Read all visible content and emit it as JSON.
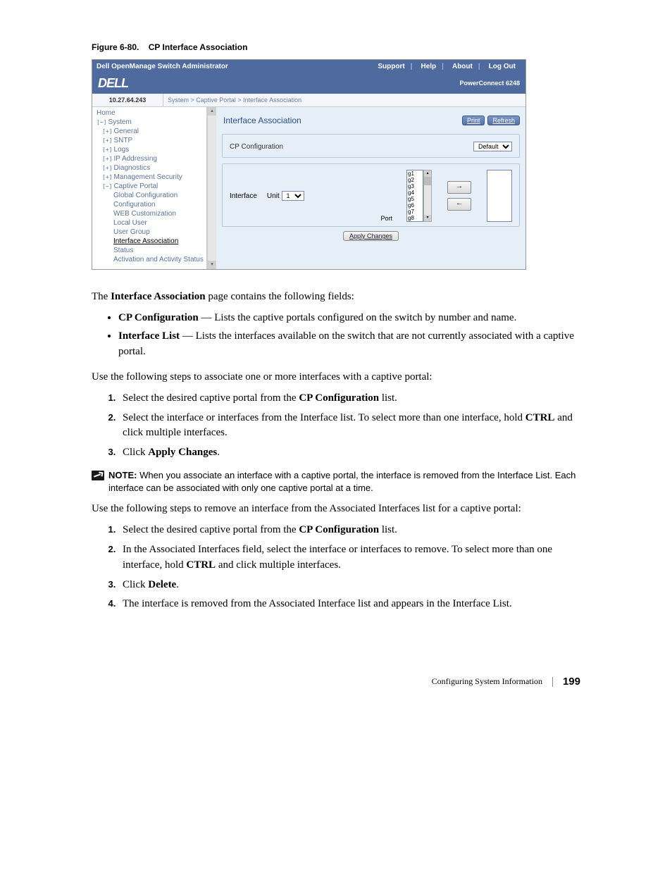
{
  "figure_caption_prefix": "Figure 6-80.",
  "figure_caption_title": "CP Interface Association",
  "screenshot": {
    "topbar": {
      "title": "Dell OpenManage Switch Administrator",
      "nav": [
        "Support",
        "Help",
        "About",
        "Log Out"
      ]
    },
    "logo": "DELL",
    "product": "PowerConnect 6248",
    "ip": "10.27.64.243",
    "breadcrumb": "System > Captive Portal > Interface Association",
    "tree": {
      "items": [
        {
          "label": "Home",
          "level": 0,
          "toggle": ""
        },
        {
          "label": "System",
          "level": 0,
          "toggle": "−"
        },
        {
          "label": "General",
          "level": 1,
          "toggle": "+"
        },
        {
          "label": "SNTP",
          "level": 1,
          "toggle": "+"
        },
        {
          "label": "Logs",
          "level": 1,
          "toggle": "+"
        },
        {
          "label": "IP Addressing",
          "level": 1,
          "toggle": "+"
        },
        {
          "label": "Diagnostics",
          "level": 1,
          "toggle": "+"
        },
        {
          "label": "Management Security",
          "level": 1,
          "toggle": "+"
        },
        {
          "label": "Captive Portal",
          "level": 1,
          "toggle": "−"
        },
        {
          "label": "Global Configuration",
          "level": 2,
          "toggle": ""
        },
        {
          "label": "Configuration",
          "level": 2,
          "toggle": ""
        },
        {
          "label": "WEB Customization",
          "level": 2,
          "toggle": ""
        },
        {
          "label": "Local User",
          "level": 2,
          "toggle": ""
        },
        {
          "label": "User Group",
          "level": 2,
          "toggle": ""
        },
        {
          "label": "Interface Association",
          "level": 2,
          "toggle": "",
          "selected": true
        },
        {
          "label": "Status",
          "level": 2,
          "toggle": ""
        },
        {
          "label": "Activation and Activity Status",
          "level": 2,
          "toggle": ""
        }
      ]
    },
    "panel": {
      "title": "Interface Association",
      "print": "Print",
      "refresh": "Refresh",
      "cp_config_label": "CP Configuration",
      "cp_config_value": "Default",
      "interface_label": "Interface",
      "unit_label": "Unit",
      "unit_value": "1",
      "port_label": "Port",
      "port_options": [
        "g1",
        "g2",
        "g3",
        "g4",
        "g5",
        "g6",
        "g7",
        "g8"
      ],
      "move_right": "→",
      "move_left": "←",
      "apply": "Apply Changes"
    }
  },
  "intro_para_pre": "The ",
  "intro_para_bold": "Interface Association",
  "intro_para_post": " page contains the following fields:",
  "bullets": [
    {
      "term": "CP Configuration",
      "desc": " — Lists the captive portals configured on the switch by number and name."
    },
    {
      "term": "Interface List",
      "desc": " — Lists the interfaces available on the switch that are not currently associated with a captive portal."
    }
  ],
  "assoc_lead": "Use the following steps to associate one or more interfaces with a captive portal:",
  "assoc_steps": [
    {
      "pre": "Select the desired captive portal from the ",
      "bold": "CP Configuration",
      "post": " list."
    },
    {
      "pre": "Select the interface or interfaces from the Interface list. To select more than one interface, hold ",
      "bold": "CTRL",
      "post": " and click multiple interfaces."
    },
    {
      "pre": "Click ",
      "bold": "Apply Changes",
      "post": "."
    }
  ],
  "note": {
    "lead": "NOTE: ",
    "text": "When you associate an interface with a captive portal, the interface is removed from the Interface List. Each interface can be associated with only one captive portal at a time."
  },
  "remove_lead": "Use the following steps to remove an interface from the Associated Interfaces list for a captive portal:",
  "remove_steps": [
    {
      "pre": "Select the desired captive portal from the ",
      "bold": "CP Configuration",
      "post": " list."
    },
    {
      "pre": "In the Associated Interfaces field, select the interface or interfaces to remove. To select more than one interface, hold ",
      "bold": "CTRL",
      "post": " and click multiple interfaces."
    },
    {
      "pre": "Click ",
      "bold": "Delete",
      "post": "."
    },
    {
      "pre": "The interface is removed from the Associated Interface list and appears in the Interface List.",
      "bold": "",
      "post": ""
    }
  ],
  "footer": {
    "section": "Configuring System Information",
    "page": "199"
  }
}
